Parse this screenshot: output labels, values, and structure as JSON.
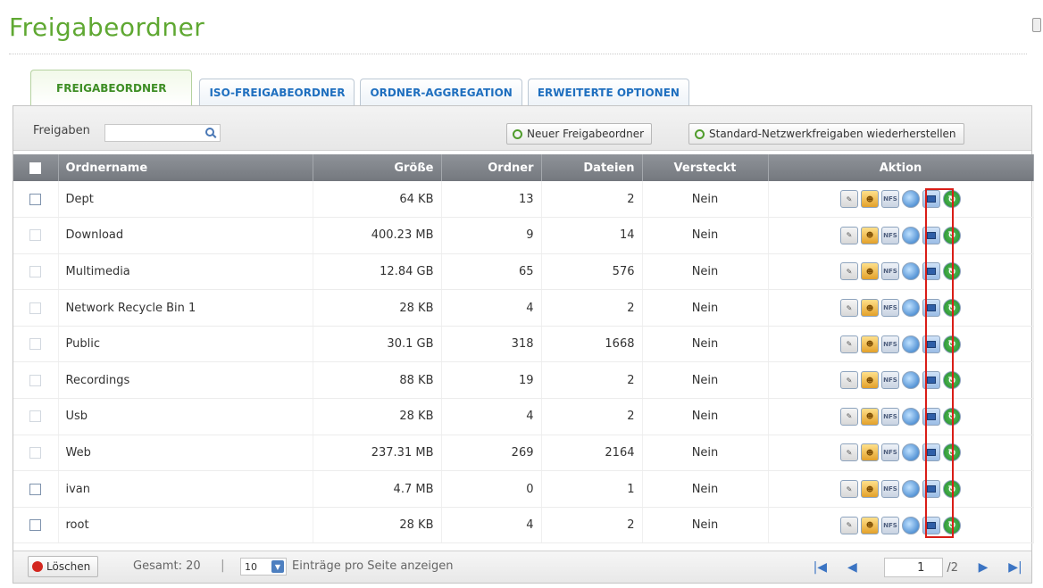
{
  "page": {
    "title": "Freigabeordner"
  },
  "tabs": [
    {
      "label": "FREIGABEORDNER",
      "active": true
    },
    {
      "label": "ISO-FREIGABEORDNER",
      "active": false
    },
    {
      "label": "ORDNER-AGGREGATION",
      "active": false
    },
    {
      "label": "ERWEITERTE OPTIONEN",
      "active": false
    }
  ],
  "toolbar": {
    "filter_label": "Freigaben",
    "new_folder_label": "Neuer Freigabeordner",
    "restore_label": "Standard-Netzwerkfreigaben wiederherstellen"
  },
  "table": {
    "columns": [
      "Ordnername",
      "Größe",
      "Ordner",
      "Dateien",
      "Versteckt",
      "Aktion"
    ],
    "rows": [
      {
        "name": "Dept",
        "size": "64 KB",
        "folders": "13",
        "files": "2",
        "hidden": "Nein",
        "checkbox_faded": false
      },
      {
        "name": "Download",
        "size": "400.23 MB",
        "folders": "9",
        "files": "14",
        "hidden": "Nein",
        "checkbox_faded": true
      },
      {
        "name": "Multimedia",
        "size": "12.84 GB",
        "folders": "65",
        "files": "576",
        "hidden": "Nein",
        "checkbox_faded": true
      },
      {
        "name": "Network Recycle Bin 1",
        "size": "28 KB",
        "folders": "4",
        "files": "2",
        "hidden": "Nein",
        "checkbox_faded": true
      },
      {
        "name": "Public",
        "size": "30.1 GB",
        "folders": "318",
        "files": "1668",
        "hidden": "Nein",
        "checkbox_faded": true
      },
      {
        "name": "Recordings",
        "size": "88 KB",
        "folders": "19",
        "files": "2",
        "hidden": "Nein",
        "checkbox_faded": true
      },
      {
        "name": "Usb",
        "size": "28 KB",
        "folders": "4",
        "files": "2",
        "hidden": "Nein",
        "checkbox_faded": true
      },
      {
        "name": "Web",
        "size": "237.31 MB",
        "folders": "269",
        "files": "2164",
        "hidden": "Nein",
        "checkbox_faded": true
      },
      {
        "name": "ivan",
        "size": "4.7 MB",
        "folders": "0",
        "files": "1",
        "hidden": "Nein",
        "checkbox_faded": false
      },
      {
        "name": "root",
        "size": "28 KB",
        "folders": "4",
        "files": "2",
        "hidden": "Nein",
        "checkbox_faded": false
      }
    ],
    "action_icons": [
      "edit-icon",
      "user-permission-icon",
      "nfs-icon",
      "web-access-icon",
      "monitor-icon",
      "refresh-icon"
    ],
    "nfs_text": "NFS"
  },
  "footer": {
    "delete_label": "Löschen",
    "total_text": "Gesamt: 20",
    "separator": "|",
    "per_page_value": "10",
    "per_page_label": "Einträge pro Seite anzeigen",
    "current_page": "1",
    "total_pages": "/2"
  },
  "colors": {
    "title_green": "#5fa832",
    "tab_blue": "#1f6fbf",
    "active_tab_green": "#3e8e25",
    "header_gray": "#74787e",
    "highlight_red": "#d91e18"
  }
}
